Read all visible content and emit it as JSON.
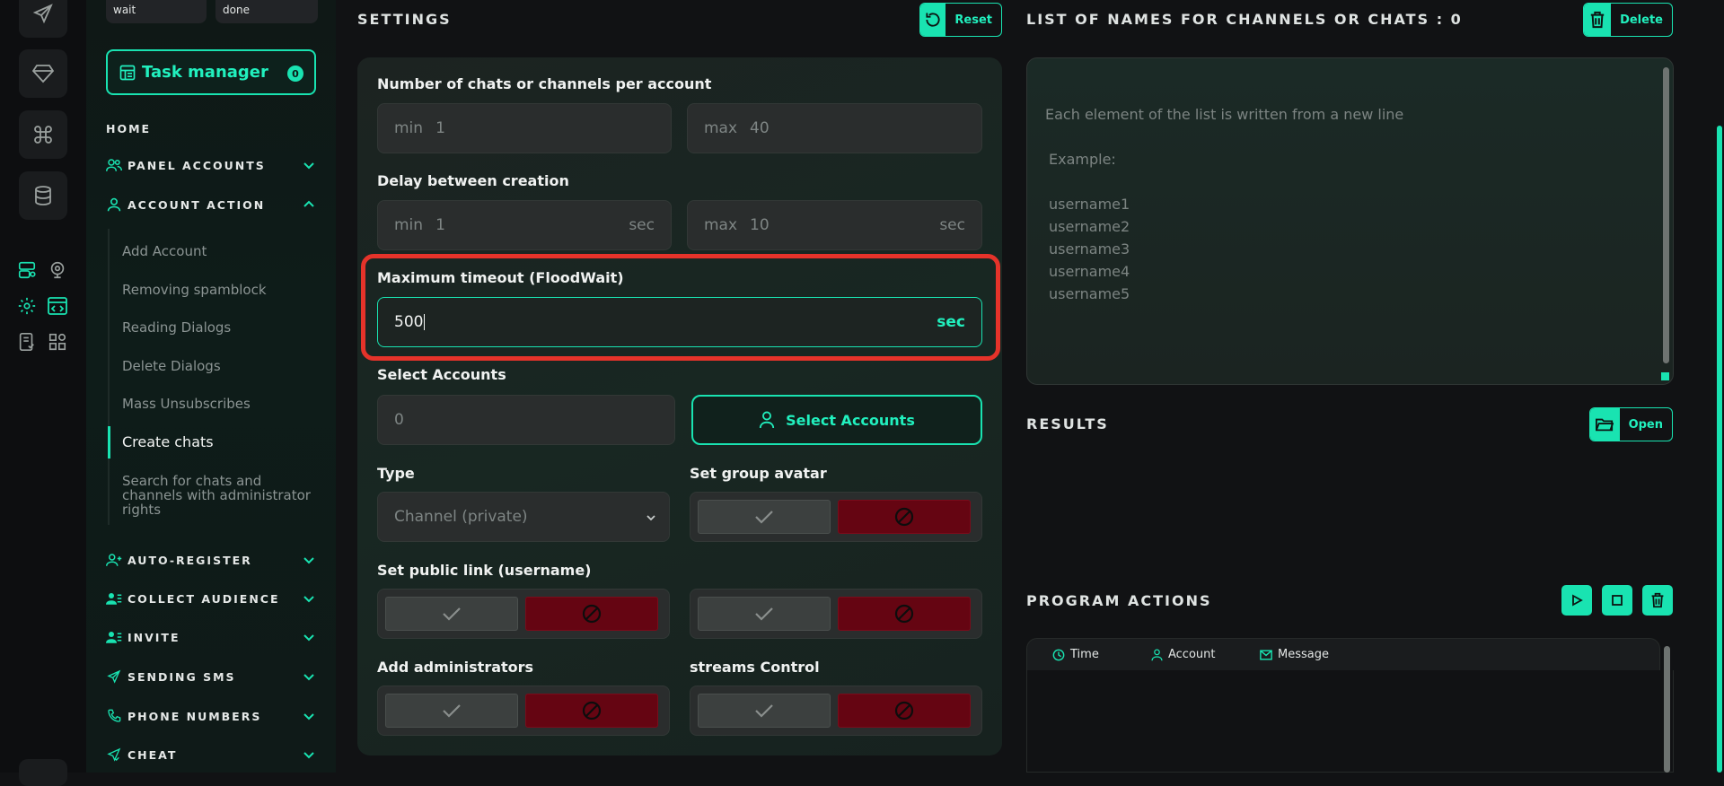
{
  "sidebar": {
    "status_tabs": [
      "wait",
      "done"
    ],
    "task_manager": {
      "label": "Task manager",
      "count": "0"
    },
    "home": "HOME",
    "sections": {
      "panel_accounts": "PANEL ACCOUNTS",
      "account_action": "ACCOUNT ACTION",
      "auto_register": "AUTO-REGISTER",
      "collect_audience": "COLLECT AUDIENCE",
      "invite": "INVITE",
      "sending_sms": "SENDING SMS",
      "phone_numbers": "PHONE NUMBERS",
      "cheat": "CHEAT"
    },
    "account_action_items": [
      "Add Account",
      "Removing spamblock",
      "Reading Dialogs",
      "Delete Dialogs",
      "Mass Unsubscribes",
      "Create chats",
      "Search for chats and channels with administrator rights"
    ],
    "active_item": "Create chats"
  },
  "settings": {
    "title": "SETTINGS",
    "reset_label": "Reset",
    "chats_per_account": {
      "label": "Number of chats or channels per account",
      "min_prefix": "min",
      "min_value": "1",
      "max_prefix": "max",
      "max_value": "40"
    },
    "delay": {
      "label": "Delay between creation",
      "min_prefix": "min",
      "min_value": "1",
      "max_prefix": "max",
      "max_value": "10",
      "unit": "sec"
    },
    "timeout": {
      "label": "Maximum timeout (FloodWait)",
      "value": "500",
      "unit": "sec"
    },
    "select_accounts": {
      "label": "Select Accounts",
      "count": "0",
      "button": "Select Accounts"
    },
    "type": {
      "label": "Type",
      "selected": "Channel (private)"
    },
    "group_avatar": {
      "label": "Set group avatar"
    },
    "public_link": {
      "label": "Set public link (username)"
    },
    "add_admins": {
      "label": "Add administrators"
    },
    "streams_control": {
      "label": "streams Control"
    }
  },
  "names_list": {
    "title": "LIST OF NAMES FOR CHANNELS OR CHATS : 0",
    "delete_label": "Delete",
    "placeholder_lines": [
      "Each element of the list is written from a new line",
      "",
      "Example:",
      "",
      "username1",
      "username2",
      "username3",
      "username4",
      "username5"
    ]
  },
  "results": {
    "title": "RESULTS",
    "open_label": "Open"
  },
  "program_actions": {
    "title": "PROGRAM ACTIONS",
    "columns": [
      "Time",
      "Account",
      "Message"
    ]
  },
  "colors": {
    "accent": "#19e3b1",
    "danger": "#650512",
    "highlight": "#e5332a"
  }
}
